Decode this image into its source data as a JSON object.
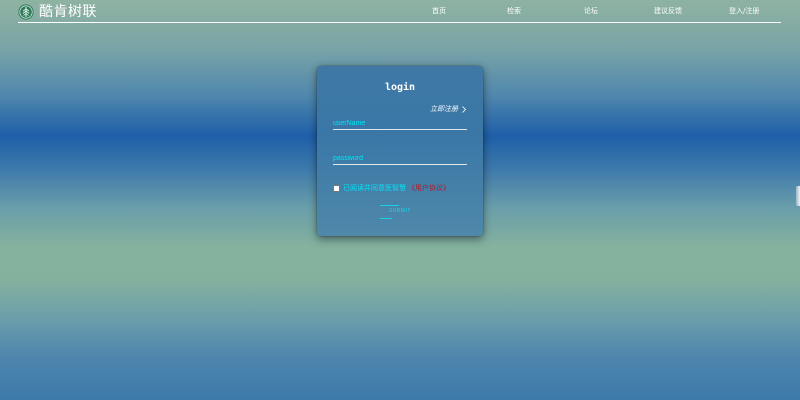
{
  "header": {
    "brand": "酷肯树联",
    "logo_icon": "tree-leaf-logo-icon",
    "nav": [
      "首页",
      "检索",
      "论坛",
      "建议反馈",
      "登入/注册"
    ]
  },
  "login": {
    "title": "login",
    "register_link": "立即注册",
    "register_icon": "chevron-right-icon",
    "username_placeholder": "userName",
    "password_placeholder": "password",
    "agree_text": "已阅读并同意医智慧",
    "agree_link": "《用户协议》",
    "submit_label": "SUBMIT"
  },
  "colors": {
    "accent": "#00e5f5",
    "link_red": "#b11a2a",
    "card_bg": "#3a77a7"
  }
}
